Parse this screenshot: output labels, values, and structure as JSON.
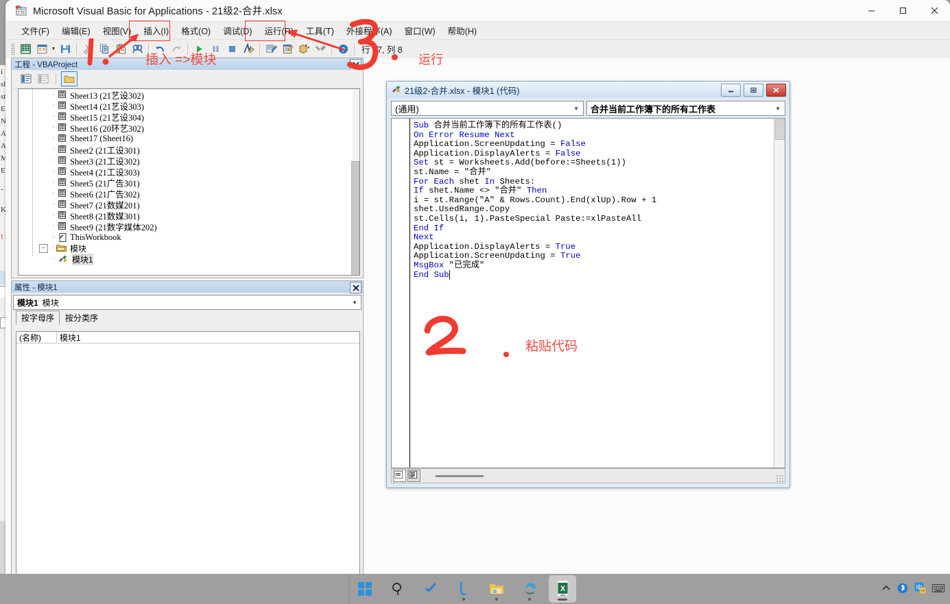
{
  "window": {
    "title": "Microsoft Visual Basic for Applications - 21级2-合并.xlsx",
    "icon": "vba-excel-icon",
    "minimize": "—",
    "maximize": "▢",
    "close": "✕"
  },
  "menubar": {
    "items": [
      {
        "label": "文件(F)",
        "name": "menu-file"
      },
      {
        "label": "编辑(E)",
        "name": "menu-edit"
      },
      {
        "label": "视图(V)",
        "name": "menu-view"
      },
      {
        "label": "插入(I)",
        "name": "menu-insert",
        "highlighted": true
      },
      {
        "label": "格式(O)",
        "name": "menu-format"
      },
      {
        "label": "调试(D)",
        "name": "menu-debug"
      },
      {
        "label": "运行(R)",
        "name": "menu-run",
        "highlighted": true
      },
      {
        "label": "工具(T)",
        "name": "menu-tools"
      },
      {
        "label": "外接程序(A)",
        "name": "menu-addins"
      },
      {
        "label": "窗口(W)",
        "name": "menu-window"
      },
      {
        "label": "帮助(H)",
        "name": "menu-help"
      }
    ]
  },
  "toolbar": {
    "status": "行 17, 列 8",
    "buttons": [
      {
        "name": "view-excel-icon",
        "glyph": "excel"
      },
      {
        "name": "insert-userform-icon",
        "glyph": "form"
      },
      {
        "name": "insert-dropdown-caret",
        "glyph": "caret"
      },
      {
        "name": "save-icon",
        "glyph": "save"
      },
      {
        "name": "cut-icon",
        "glyph": "cut"
      },
      {
        "name": "copy-icon",
        "glyph": "copy"
      },
      {
        "name": "paste-icon",
        "glyph": "paste"
      },
      {
        "name": "find-icon",
        "glyph": "find"
      },
      {
        "name": "undo-icon",
        "glyph": "undo"
      },
      {
        "name": "redo-icon",
        "glyph": "redo"
      },
      {
        "name": "run-sub-icon",
        "glyph": "play"
      },
      {
        "name": "break-icon",
        "glyph": "pause"
      },
      {
        "name": "reset-icon",
        "glyph": "stop"
      },
      {
        "name": "design-mode-icon",
        "glyph": "design"
      },
      {
        "name": "project-explorer-icon",
        "glyph": "project"
      },
      {
        "name": "properties-window-icon",
        "glyph": "props"
      },
      {
        "name": "object-browser-icon",
        "glyph": "browser"
      },
      {
        "name": "toolbox-icon",
        "glyph": "toolbox"
      },
      {
        "name": "help-icon",
        "glyph": "help"
      }
    ]
  },
  "project_panel": {
    "title": "工程 - VBAProject",
    "close_label": "✕",
    "toolbar_buttons": [
      {
        "name": "view-code-button",
        "glyph": "code"
      },
      {
        "name": "view-object-button",
        "glyph": "object"
      },
      {
        "name": "toggle-folders-button",
        "glyph": "folder",
        "active": true
      }
    ],
    "tree": [
      {
        "label": "Sheet13 (21艺设302)",
        "type": "sheet",
        "indent": 2
      },
      {
        "label": "Sheet14 (21艺设303)",
        "type": "sheet",
        "indent": 2
      },
      {
        "label": "Sheet15 (21艺设304)",
        "type": "sheet",
        "indent": 2
      },
      {
        "label": "Sheet16 (20环艺302)",
        "type": "sheet",
        "indent": 2
      },
      {
        "label": "Sheet17 (Sheet16)",
        "type": "sheet",
        "indent": 2
      },
      {
        "label": "Sheet2 (21工设301)",
        "type": "sheet",
        "indent": 2
      },
      {
        "label": "Sheet3 (21工设302)",
        "type": "sheet",
        "indent": 2
      },
      {
        "label": "Sheet4 (21工设303)",
        "type": "sheet",
        "indent": 2
      },
      {
        "label": "Sheet5 (21广告301)",
        "type": "sheet",
        "indent": 2
      },
      {
        "label": "Sheet6 (21广告302)",
        "type": "sheet",
        "indent": 2
      },
      {
        "label": "Sheet7 (21数媒201)",
        "type": "sheet",
        "indent": 2
      },
      {
        "label": "Sheet8 (21数媒301)",
        "type": "sheet",
        "indent": 2
      },
      {
        "label": "Sheet9 (21数字媒体202)",
        "type": "sheet",
        "indent": 2
      },
      {
        "label": "ThisWorkbook",
        "type": "workbook",
        "indent": 2
      },
      {
        "label": "模块",
        "type": "folder",
        "indent": 1,
        "expander": "−"
      },
      {
        "label": "模块1",
        "type": "module",
        "indent": 2,
        "selected": true
      }
    ]
  },
  "properties_panel": {
    "title": "属性 - 模块1",
    "close_label": "✕",
    "object_bold": "模块1",
    "object_type": "模块",
    "tabs": [
      {
        "label": "按字母序",
        "active": true
      },
      {
        "label": "按分类序",
        "active": false
      }
    ],
    "rows": [
      {
        "key": "(名称)",
        "value": "模块1"
      }
    ]
  },
  "code_window": {
    "title": "21级2-合并.xlsx - 模块1 (代码)",
    "icon": "module-icon",
    "minimize": "—",
    "restore": "❐",
    "close": "✕",
    "combo_left": "(通用)",
    "combo_right": "合并当前工作簿下的所有工作表",
    "code_lines": [
      {
        "text": "Sub 合并当前工作簿下的所有工作表()",
        "kw": "Sub"
      },
      {
        "text": "On Error Resume Next",
        "kw": "On Error Resume Next"
      },
      {
        "text": "Application.ScreenUpdating = False",
        "kw": "False"
      },
      {
        "text": "Application.DisplayAlerts = False",
        "kw": "False"
      },
      {
        "text": "Set st = Worksheets.Add(before:=Sheets(1))",
        "kw": "Set"
      },
      {
        "text": "st.Name = \"合并\"",
        "kw": ""
      },
      {
        "text": "For Each shet In Sheets:",
        "kw": "For Each ... In"
      },
      {
        "text": "If shet.Name <> \"合并\" Then",
        "kw": "If ... Then"
      },
      {
        "text": "i = st.Range(\"A\" & Rows.Count).End(xlUp).Row + 1",
        "kw": ""
      },
      {
        "text": "shet.UsedRange.Copy",
        "kw": ""
      },
      {
        "text": "st.Cells(i, 1).PasteSpecial Paste:=xlPasteAll",
        "kw": ""
      },
      {
        "text": "End If",
        "kw": "End If"
      },
      {
        "text": "Next",
        "kw": "Next"
      },
      {
        "text": "Application.DisplayAlerts = True",
        "kw": "True"
      },
      {
        "text": "Application.ScreenUpdating = True",
        "kw": "True"
      },
      {
        "text": "MsgBox \"已完成\"",
        "kw": "MsgBox"
      },
      {
        "text": "End Sub",
        "kw": "End Sub"
      }
    ],
    "view_buttons": [
      {
        "name": "procedure-view-button"
      },
      {
        "name": "full-module-view-button",
        "pressed": true
      }
    ]
  },
  "annotations": [
    {
      "name": "annotation-step-1",
      "text": "1",
      "type": "stroke"
    },
    {
      "name": "annotation-insert-module",
      "text": "插入 =>模块",
      "type": "text"
    },
    {
      "name": "annotation-step-2",
      "text": "2",
      "type": "stroke"
    },
    {
      "name": "annotation-paste-code",
      "text": "粘贴代码",
      "type": "text"
    },
    {
      "name": "annotation-step-3",
      "text": "3",
      "type": "stroke"
    },
    {
      "name": "annotation-run",
      "text": "运行",
      "type": "text"
    }
  ],
  "taskbar": {
    "items": [
      {
        "name": "start-button",
        "glyph": "windows"
      },
      {
        "name": "search-button",
        "glyph": "search"
      },
      {
        "name": "task-view-button",
        "glyph": "check"
      },
      {
        "name": "lark-app-button",
        "glyph": "L"
      },
      {
        "name": "file-explorer-button",
        "glyph": "folder"
      },
      {
        "name": "edge-browser-button",
        "glyph": "edge"
      },
      {
        "name": "excel-app-button",
        "glyph": "excel",
        "active": true
      }
    ],
    "tray": [
      {
        "name": "show-hidden-icons-button",
        "glyph": "∧"
      },
      {
        "name": "bluetooth-icon",
        "glyph": "bt"
      },
      {
        "name": "ime-icon",
        "glyph": "ime"
      },
      {
        "name": "keyboard-icon",
        "glyph": "kb"
      }
    ]
  },
  "background_window_fragments": [
    "i",
    "sh",
    "st",
    "En",
    "Ne",
    "Ap",
    "Ap",
    "Ms",
    "En",
    "-",
    "K/",
    "!"
  ],
  "colors": {
    "accent_red": "#e8352c",
    "title_blue": "#10335c",
    "keyword_blue": "#0000c0"
  }
}
